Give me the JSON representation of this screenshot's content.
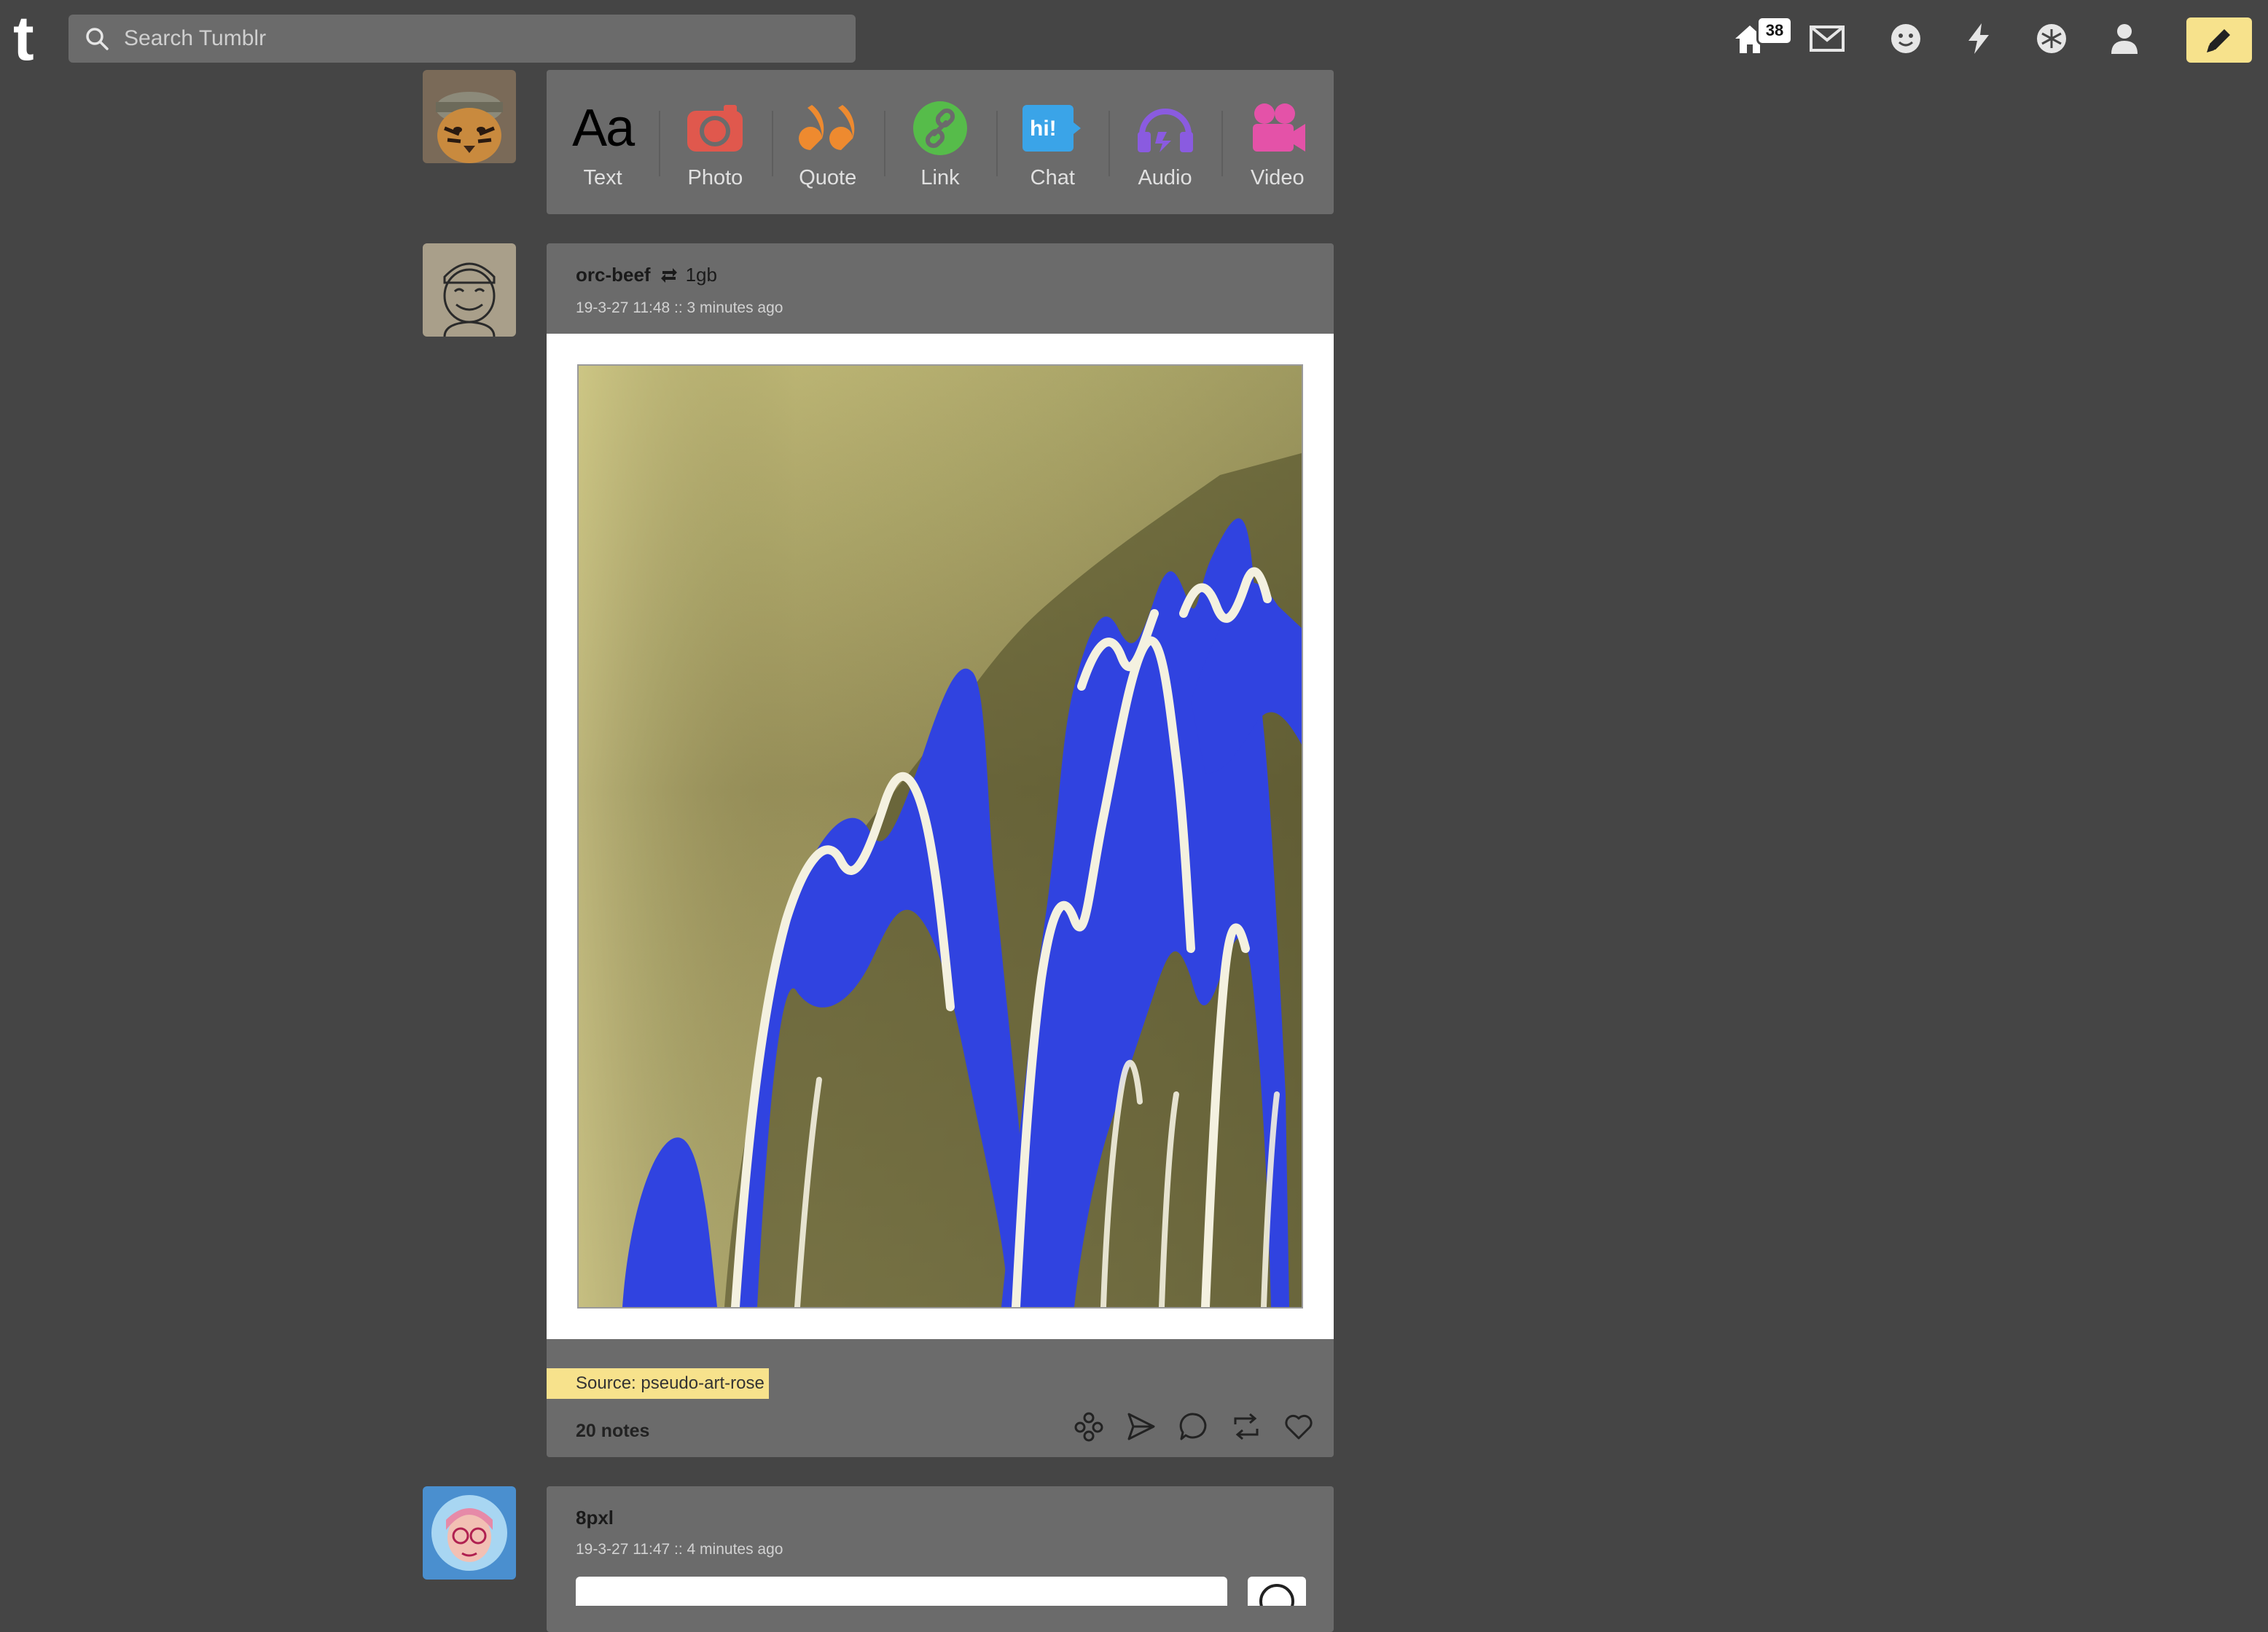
{
  "topbar": {
    "logo": "t",
    "search_placeholder": "Search Tumblr",
    "home_badge": "38",
    "icons": [
      "home-icon",
      "mail-icon",
      "messaging-icon",
      "activity-icon",
      "explore-icon",
      "account-icon",
      "compose-icon"
    ]
  },
  "post_types": [
    {
      "label": "Text",
      "icon": "text-icon",
      "color": "#000000"
    },
    {
      "label": "Photo",
      "icon": "photo-icon",
      "color": "#e0584d"
    },
    {
      "label": "Quote",
      "icon": "quote-icon",
      "color": "#ee8a2f"
    },
    {
      "label": "Link",
      "icon": "link-icon",
      "color": "#56bc4a"
    },
    {
      "label": "Chat",
      "icon": "chat-icon",
      "color": "#3aa4e8"
    },
    {
      "label": "Audio",
      "icon": "audio-icon",
      "color": "#8a5be0"
    },
    {
      "label": "Video",
      "icon": "video-icon",
      "color": "#e452a8"
    }
  ],
  "posts": [
    {
      "username": "orc-beef",
      "reblogged_from": "1gb",
      "timestamp": "19-3-27 11:48 :: 3 minutes ago",
      "source": "Source: pseudo-art-rose",
      "notes": "20 notes"
    },
    {
      "username": "8pxl",
      "timestamp": "19-3-27 11:47 :: 4 minutes ago"
    }
  ],
  "colors": {
    "background": "#454545",
    "panel": "#6b6b6b",
    "accent": "#f7e28c"
  }
}
